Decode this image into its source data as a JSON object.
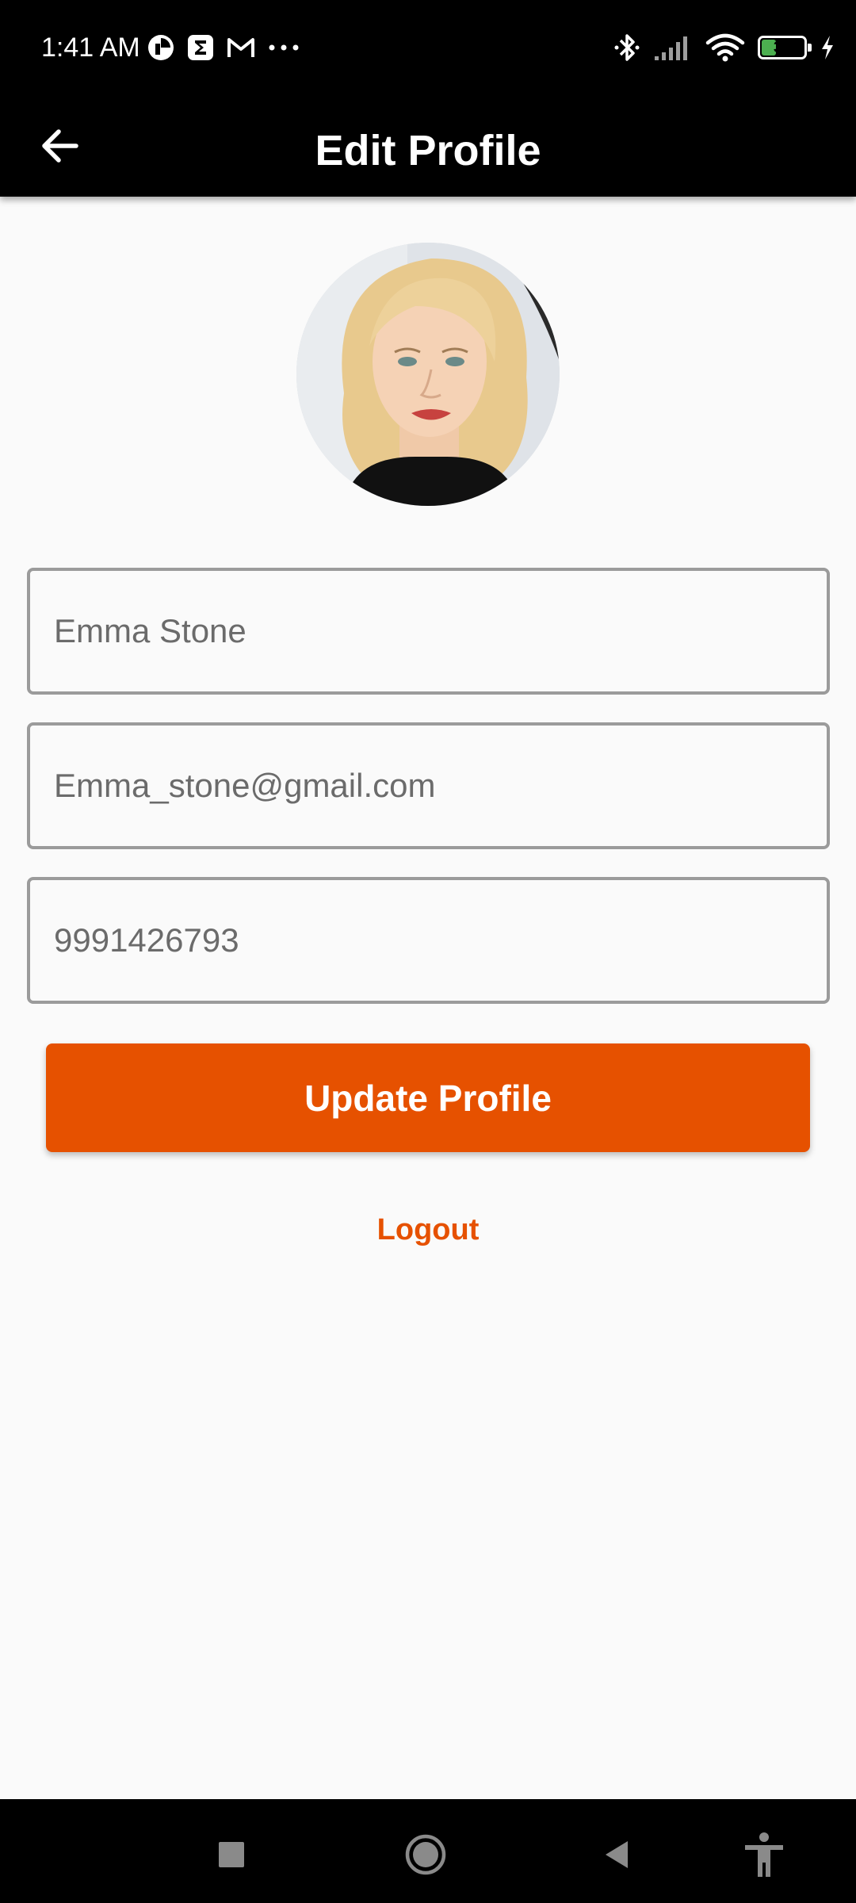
{
  "status_bar": {
    "time": "1:41 AM",
    "left_icons": [
      "pinwheel-icon",
      "sigma-icon",
      "gmail-icon",
      "more-dots-icon"
    ],
    "right_icons": [
      "bluetooth-icon",
      "cellular-signal-icon",
      "wifi-icon",
      "battery-icon",
      "charging-bolt-icon"
    ],
    "battery_level": "32"
  },
  "app_bar": {
    "title": "Edit Profile",
    "back_icon": "arrow-left-icon"
  },
  "profile": {
    "avatar_alt": "Emma Stone"
  },
  "form": {
    "name_value": "Emma Stone",
    "email_value": "Emma_stone@gmail.com",
    "phone_value": "9991426793"
  },
  "actions": {
    "update_label": "Update Profile",
    "logout_label": "Logout"
  },
  "colors": {
    "accent": "#e65100",
    "bar_background": "#000000",
    "page_background": "#fafafa",
    "field_border": "#9b9b9b"
  },
  "nav_bar": {
    "icons": [
      "recents-square-icon",
      "home-circle-icon",
      "back-triangle-icon",
      "accessibility-icon"
    ]
  }
}
